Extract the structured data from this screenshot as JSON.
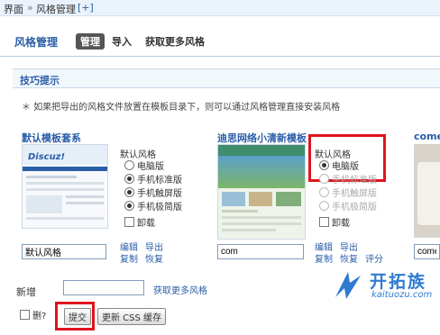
{
  "breadcrumb": {
    "root": "界面",
    "sep": "»",
    "current": "风格管理",
    "plus": "[+]"
  },
  "header": {
    "title": "风格管理",
    "tabs": [
      "管理",
      "导入",
      "获取更多风格"
    ]
  },
  "tips": {
    "heading": "技巧提示",
    "text": "如果把导出的风格文件放置在模板目录下，则可以通过风格管理直接安装风格"
  },
  "templates": [
    {
      "title": "默认模板套系",
      "thumb_brand": "Discuz!",
      "radio_group_label": "默认风格",
      "radios": [
        "电脑版",
        "手机标准版",
        "手机触屏版",
        "手机极简版"
      ],
      "checkbox_label": "卸载",
      "name_value": "默认风格",
      "actions": [
        "编辑",
        "导出",
        "复制",
        "恢复"
      ]
    },
    {
      "title": "迪思网络小清新模板",
      "radio_group_label": "默认风格",
      "radios": [
        "电脑版",
        "手机标准版",
        "手机触屏版",
        "手机极简版"
      ],
      "checkbox_label": "卸载",
      "name_value": "com",
      "actions": [
        "编辑",
        "导出",
        "复制",
        "恢复",
        "评分"
      ]
    },
    {
      "title": "comei",
      "name_value": "comei"
    }
  ],
  "new_row": {
    "label": "新增",
    "input_value": "",
    "link": "获取更多风格"
  },
  "footer": {
    "delete_label": "删?",
    "submit_label": "提交",
    "refresh_css_label": "更新 CSS 缓存"
  },
  "watermark": {
    "name": "开拓族",
    "url": "kaituozu.com"
  },
  "colors": {
    "accent": "#2b5ea8",
    "highlight": "#e0141e",
    "watermark": "#2f7bd0"
  }
}
